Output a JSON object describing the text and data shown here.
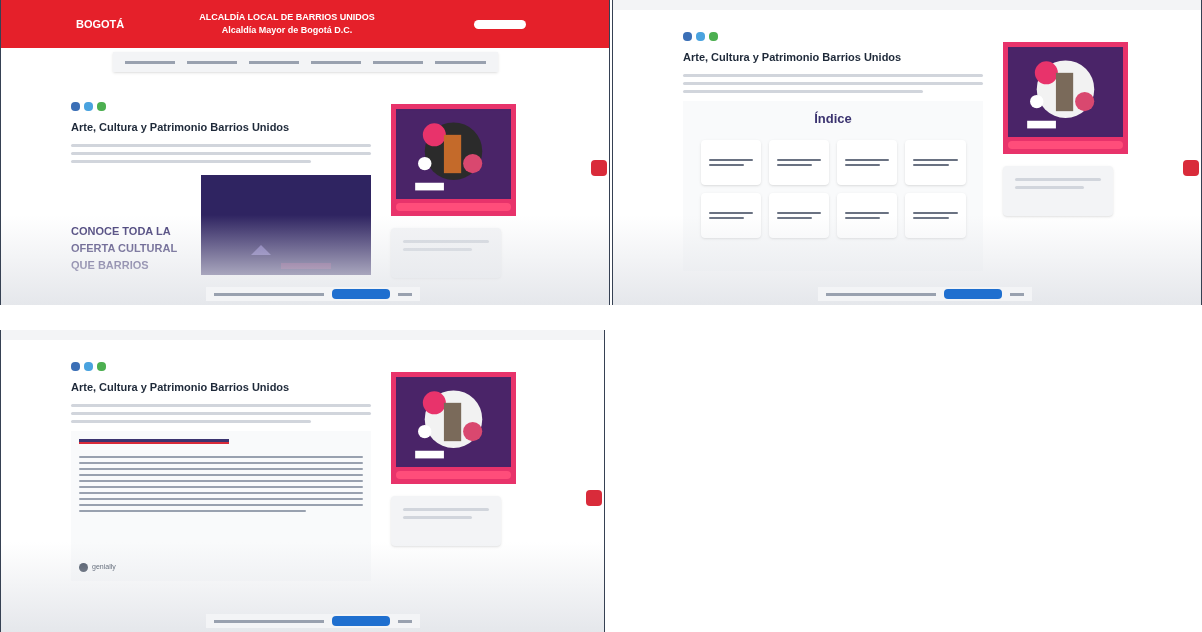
{
  "screens": [
    {
      "kind": "header_view",
      "header": {
        "logo": "BOGOTÁ",
        "title": "ALCALDÍA LOCAL DE BARRIOS UNIDOS",
        "subtitle": "Alcaldía Mayor de Bogotá D.C."
      },
      "page_title": "Arte, Cultura y Patrimonio Barrios Unidos",
      "banner_lines": [
        "CONOCE TODA LA",
        "OFERTA CULTURAL",
        "QUE BARRIOS"
      ]
    },
    {
      "kind": "index_view",
      "page_title": "Arte, Cultura y Patrimonio Barrios Unidos",
      "index_title": "Índice"
    },
    {
      "kind": "embed_view",
      "page_title": "Arte, Cultura y Patrimonio Barrios Unidos",
      "embed_brand": "genially"
    }
  ]
}
